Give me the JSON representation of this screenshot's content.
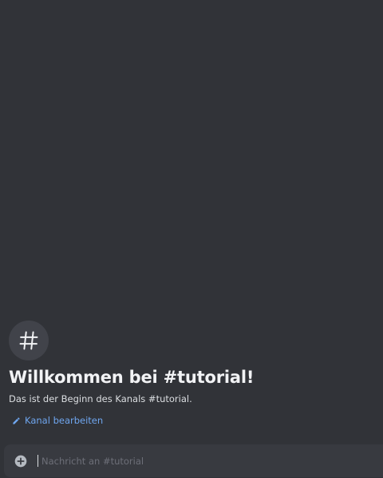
{
  "channel": {
    "name": "#tutorial",
    "icon": "hash-icon"
  },
  "welcome": {
    "title": "Willkommen bei #tutorial!",
    "subtitle": "Das ist der Beginn des Kanals #tutorial.",
    "edit_label": "Kanal bearbeiten",
    "edit_icon": "pencil-icon"
  },
  "composer": {
    "placeholder": "Nachricht an #tutorial",
    "value": "",
    "attach_icon": "plus-circle-icon"
  },
  "colors": {
    "background": "#313338",
    "composer": "#383a40",
    "link": "#00a8fc"
  }
}
